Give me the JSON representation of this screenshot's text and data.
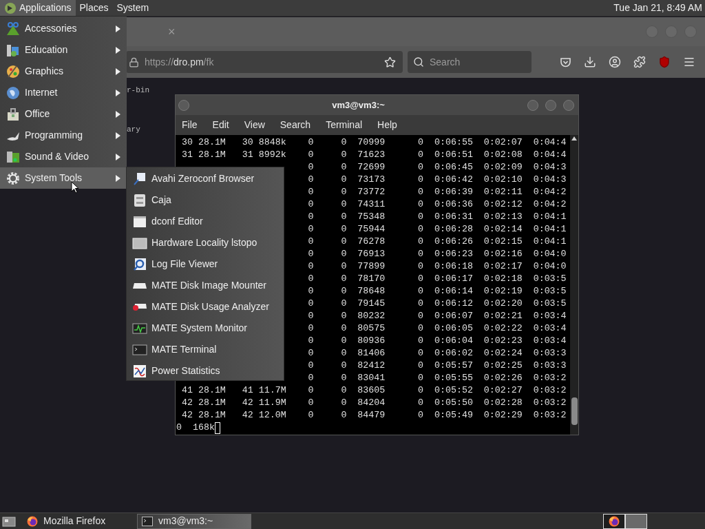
{
  "top_panel": {
    "menus": [
      {
        "label": "Applications",
        "selected": true
      },
      {
        "label": "Places",
        "selected": false
      },
      {
        "label": "System",
        "selected": false
      }
    ],
    "clock": "Tue Jan 21, 8:49 AM"
  },
  "browser": {
    "tab_close": "×",
    "url": {
      "scheme": "https://",
      "host": "dro.pm",
      "path": "/fk"
    },
    "search_placeholder": "Search",
    "page_lines": [
      "r-bin",
      "ary"
    ]
  },
  "terminal": {
    "title": "vm3@vm3:~",
    "menu": [
      "File",
      "Edit",
      "View",
      "Search",
      "Terminal",
      "Help"
    ],
    "rows": [
      {
        "left": "30 28.1M   30 8848k",
        "right": "0     0  70999      0  0:06:55  0:02:07  0:04:4"
      },
      {
        "left": "31 28.1M   31 8992k",
        "right": "0     0  71623      0  0:06:51  0:02:08  0:04:4"
      },
      {
        "right": "0     0  72699      0  0:06:45  0:02:09  0:04:3"
      },
      {
        "right": "0     0  73173      0  0:06:42  0:02:10  0:04:3"
      },
      {
        "right": "0     0  73772      0  0:06:39  0:02:11  0:04:2"
      },
      {
        "right": "0     0  74311      0  0:06:36  0:02:12  0:04:2"
      },
      {
        "right": "0     0  75348      0  0:06:31  0:02:13  0:04:1"
      },
      {
        "right": "0     0  75944      0  0:06:28  0:02:14  0:04:1"
      },
      {
        "right": "0     0  76278      0  0:06:26  0:02:15  0:04:1"
      },
      {
        "right": "0     0  76913      0  0:06:23  0:02:16  0:04:0"
      },
      {
        "right": "0     0  77899      0  0:06:18  0:02:17  0:04:0"
      },
      {
        "right": "0     0  78170      0  0:06:17  0:02:18  0:03:5"
      },
      {
        "right": "0     0  78648      0  0:06:14  0:02:19  0:03:5"
      },
      {
        "right": "0     0  79145      0  0:06:12  0:02:20  0:03:5"
      },
      {
        "right": "0     0  80232      0  0:06:07  0:02:21  0:03:4"
      },
      {
        "right": "0     0  80575      0  0:06:05  0:02:22  0:03:4"
      },
      {
        "right": "0     0  80936      0  0:06:04  0:02:23  0:03:4"
      },
      {
        "right": "0     0  81406      0  0:06:02  0:02:24  0:03:3"
      },
      {
        "right": "0     0  82412      0  0:05:57  0:02:25  0:03:3"
      },
      {
        "right": "0     0  83041      0  0:05:55  0:02:26  0:03:2"
      },
      {
        "left": "41 28.1M   41 11.7M",
        "right": "0     0  83605      0  0:05:52  0:02:27  0:03:2"
      },
      {
        "left": "42 28.1M   42 11.9M",
        "right": "0     0  84204      0  0:05:50  0:02:28  0:03:2"
      },
      {
        "left": "42 28.1M   42 12.0M",
        "right": "0     0  84479      0  0:05:49  0:02:29  0:03:2"
      }
    ],
    "prompt": "0  168k"
  },
  "applications_menu": {
    "items": [
      {
        "label": "Accessories",
        "selected": false
      },
      {
        "label": "Education",
        "selected": false
      },
      {
        "label": "Graphics",
        "selected": false
      },
      {
        "label": "Internet",
        "selected": false
      },
      {
        "label": "Office",
        "selected": false
      },
      {
        "label": "Programming",
        "selected": false
      },
      {
        "label": "Sound & Video",
        "selected": false
      },
      {
        "label": "System Tools",
        "selected": true
      }
    ]
  },
  "submenu": {
    "items": [
      "Avahi Zeroconf Browser",
      "Caja",
      "dconf Editor",
      "Hardware Locality lstopo",
      "Log File Viewer",
      "MATE Disk Image Mounter",
      "MATE Disk Usage Analyzer",
      "MATE System Monitor",
      "MATE Terminal",
      "Power Statistics"
    ]
  },
  "taskbar": {
    "tasks": [
      {
        "label": "Mozilla Firefox",
        "selected": false
      },
      {
        "label": "vm3@vm3:~",
        "selected": true
      }
    ],
    "workspaces": [
      {
        "selected": false
      },
      {
        "selected": true
      }
    ]
  }
}
